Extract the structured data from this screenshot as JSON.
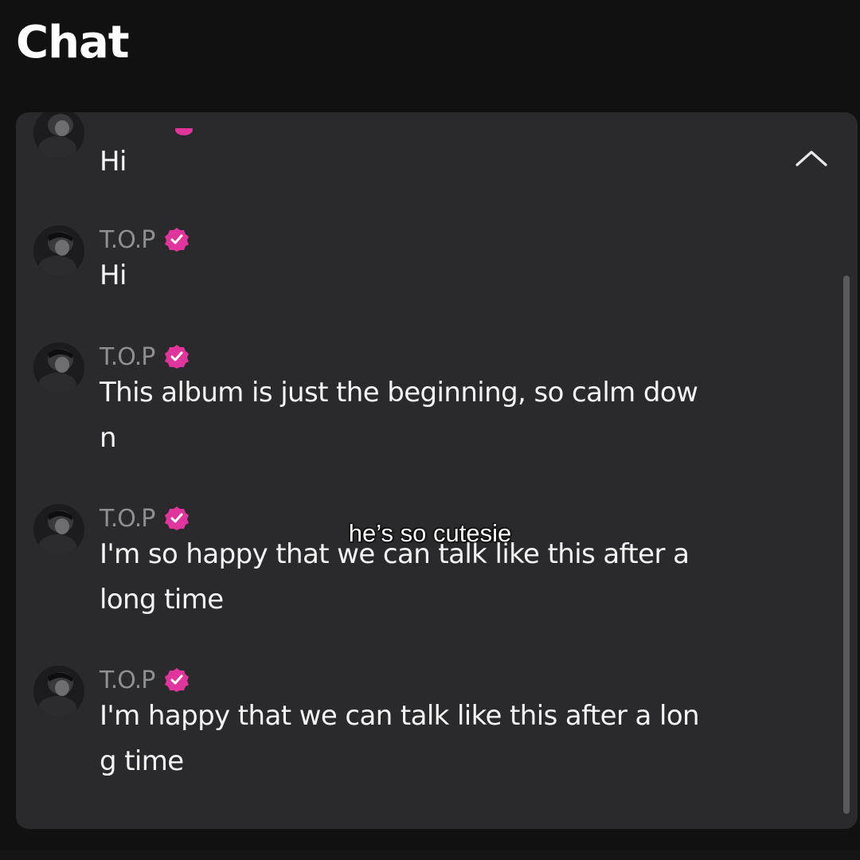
{
  "header": {
    "title": "Chat"
  },
  "chat": {
    "collapse_icon": "chevron-up-icon",
    "messages": [
      {
        "sender": "",
        "text": "Hi",
        "avatar_icon": "avatar-photo",
        "verified": true
      },
      {
        "sender": "T.O.P",
        "text": "Hi",
        "avatar_icon": "avatar-photo",
        "verified": true
      },
      {
        "sender": "T.O.P",
        "text": "This album is just the beginning, so calm dow n",
        "line1": "This album is just the beginning, so calm dow",
        "line2": "n",
        "avatar_icon": "avatar-photo",
        "verified": true
      },
      {
        "sender": "T.O.P",
        "line1": "I'm so happy that we can talk like this after a",
        "line2": "long time",
        "avatar_icon": "avatar-photo",
        "verified": true
      },
      {
        "sender": "T.O.P",
        "line1": "I'm happy that we can talk like this after a lon",
        "line2": "g time",
        "avatar_icon": "avatar-photo",
        "verified": true
      }
    ]
  },
  "overlay": {
    "caption": "he’s so cutesie"
  },
  "colors": {
    "background": "#111112",
    "panel": "#2a2a2c",
    "verified_badge": "#e0359c",
    "sender_name": "#8e8e93",
    "message_text": "#f4f4f4"
  }
}
